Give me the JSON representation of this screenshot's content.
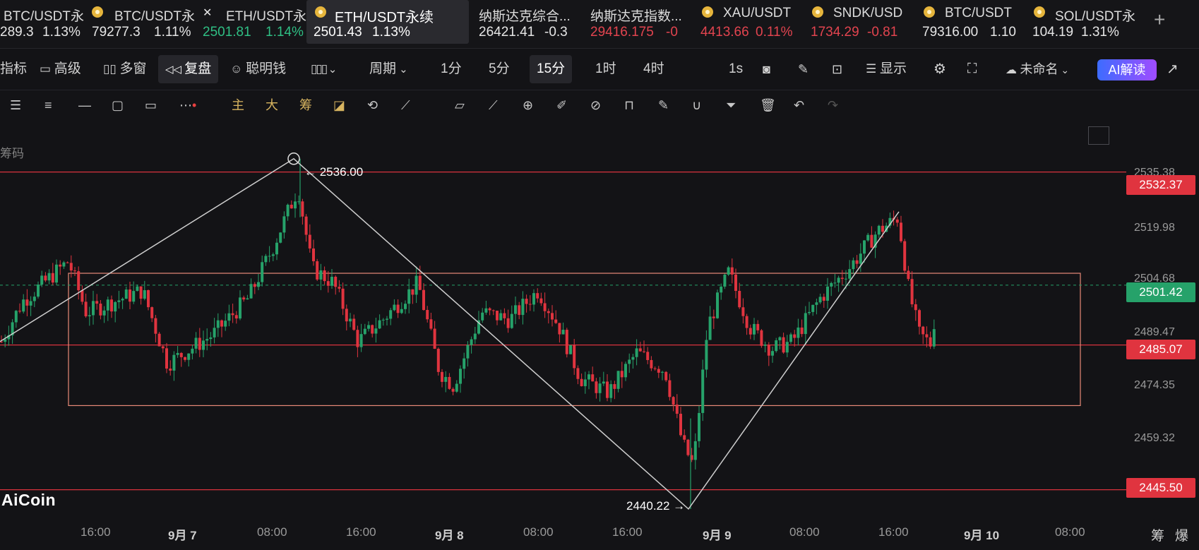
{
  "tickers": [
    {
      "name": "BTC/USDT永",
      "price": "289.3",
      "change": "1.13%",
      "icon": "bnb-coin-icon",
      "price_color": "#e6e6e6",
      "change_color": "#e6e6e6",
      "active": false
    },
    {
      "name": "BTC/USDT永",
      "price": "79277.3",
      "change": "1.11%",
      "icon": "bnb-coin-icon",
      "price_color": "#e6e6e6",
      "change_color": "#e6e6e6",
      "active": false
    },
    {
      "name": "ETH/USDT永",
      "price": "2501.81",
      "change": "1.14%",
      "icon": "x-exchange-icon",
      "price_color": "#2fbf84",
      "change_color": "#2fbf84",
      "active": false
    },
    {
      "name": "ETH/USDT永续",
      "price": "2501.43",
      "change": "1.13%",
      "icon": "bnb-coin-icon",
      "price_color": "#e6e6e6",
      "change_color": "#e6e6e6",
      "active": true
    },
    {
      "name": "纳斯达克综合...",
      "price": "26421.41",
      "change": "-0.3",
      "icon": "",
      "price_color": "#e6e6e6",
      "change_color": "#e6e6e6",
      "active": false
    },
    {
      "name": "纳斯达克指数...",
      "price": "29416.175",
      "change": "-0",
      "icon": "",
      "price_color": "#e2444f",
      "change_color": "#e2444f",
      "active": false
    },
    {
      "name": "XAU/USDT",
      "price": "4413.66",
      "change": "0.11%",
      "icon": "bnb-coin-icon",
      "price_color": "#e2444f",
      "change_color": "#e2444f",
      "active": false
    },
    {
      "name": "SNDK/USD",
      "price": "1734.29",
      "change": "-0.81",
      "icon": "bnb-coin-icon",
      "price_color": "#e2444f",
      "change_color": "#e2444f",
      "active": false
    },
    {
      "name": "BTC/USDT",
      "price": "79316.00",
      "change": "1.10",
      "icon": "bnb-coin-icon",
      "price_color": "#e6e6e6",
      "change_color": "#e6e6e6",
      "active": false
    },
    {
      "name": "SOL/USDT永",
      "price": "104.19",
      "change": "1.31%",
      "icon": "bnb-coin-icon",
      "price_color": "#e6e6e6",
      "change_color": "#e6e6e6",
      "active": false
    }
  ],
  "toolbar": {
    "indicators": "指标",
    "advanced": "高级",
    "multi_window": "多窗",
    "replay": "复盘",
    "smart_money": "聪明钱",
    "period": "周期",
    "intervals": [
      "1分",
      "5分",
      "15分",
      "1时",
      "4时"
    ],
    "active_interval": "15分",
    "one_s": "1s",
    "display": "显示",
    "layout_name": "未命名",
    "ai_read": "AI解读"
  },
  "drawing_tools": {
    "main": "主",
    "big": "大",
    "chips": "筹"
  },
  "chart": {
    "chip_label": "筹码",
    "logo": "AiCoin",
    "peak_annotation": "← 2536.00",
    "trough_annotation": "2440.22 →",
    "bottom_right": [
      "筹",
      "爆"
    ]
  },
  "chart_data": {
    "type": "candlestick",
    "symbol": "ETH/USDT永续",
    "interval": "15分",
    "y_ticks": [
      "2535.38",
      "2519.98",
      "2504.68",
      "2489.47",
      "2474.35",
      "2459.32"
    ],
    "price_tags": [
      {
        "value": "2532.37",
        "color": "#e0343f"
      },
      {
        "value": "2501.42",
        "color": "#26a26a"
      },
      {
        "value": "2485.07",
        "color": "#e0343f"
      },
      {
        "value": "2445.50",
        "color": "#e0343f"
      }
    ],
    "x_ticks": [
      {
        "label": "16:00",
        "bold": false
      },
      {
        "label": "9月 7",
        "bold": true
      },
      {
        "label": "08:00",
        "bold": false
      },
      {
        "label": "16:00",
        "bold": false
      },
      {
        "label": "9月 8",
        "bold": true
      },
      {
        "label": "08:00",
        "bold": false
      },
      {
        "label": "16:00",
        "bold": false
      },
      {
        "label": "9月 9",
        "bold": true
      },
      {
        "label": "08:00",
        "bold": false
      },
      {
        "label": "16:00",
        "bold": false
      },
      {
        "label": "9月 10",
        "bold": true
      },
      {
        "label": "08:00",
        "bold": false
      }
    ],
    "horizontal_lines": [
      2532.37,
      2485.07,
      2445.5
    ],
    "current_price": 2501.42,
    "range_box": {
      "top": 2504.68,
      "bottom": 2468.5
    },
    "swing_points": [
      {
        "label": "start",
        "value": 2486.0
      },
      {
        "label": "peak",
        "value": 2536.0
      },
      {
        "label": "trough",
        "value": 2440.22
      },
      {
        "label": "end",
        "value": 2521.5
      }
    ],
    "colors": {
      "up": "#26a26a",
      "down": "#e0343f",
      "background": "#131316"
    }
  }
}
